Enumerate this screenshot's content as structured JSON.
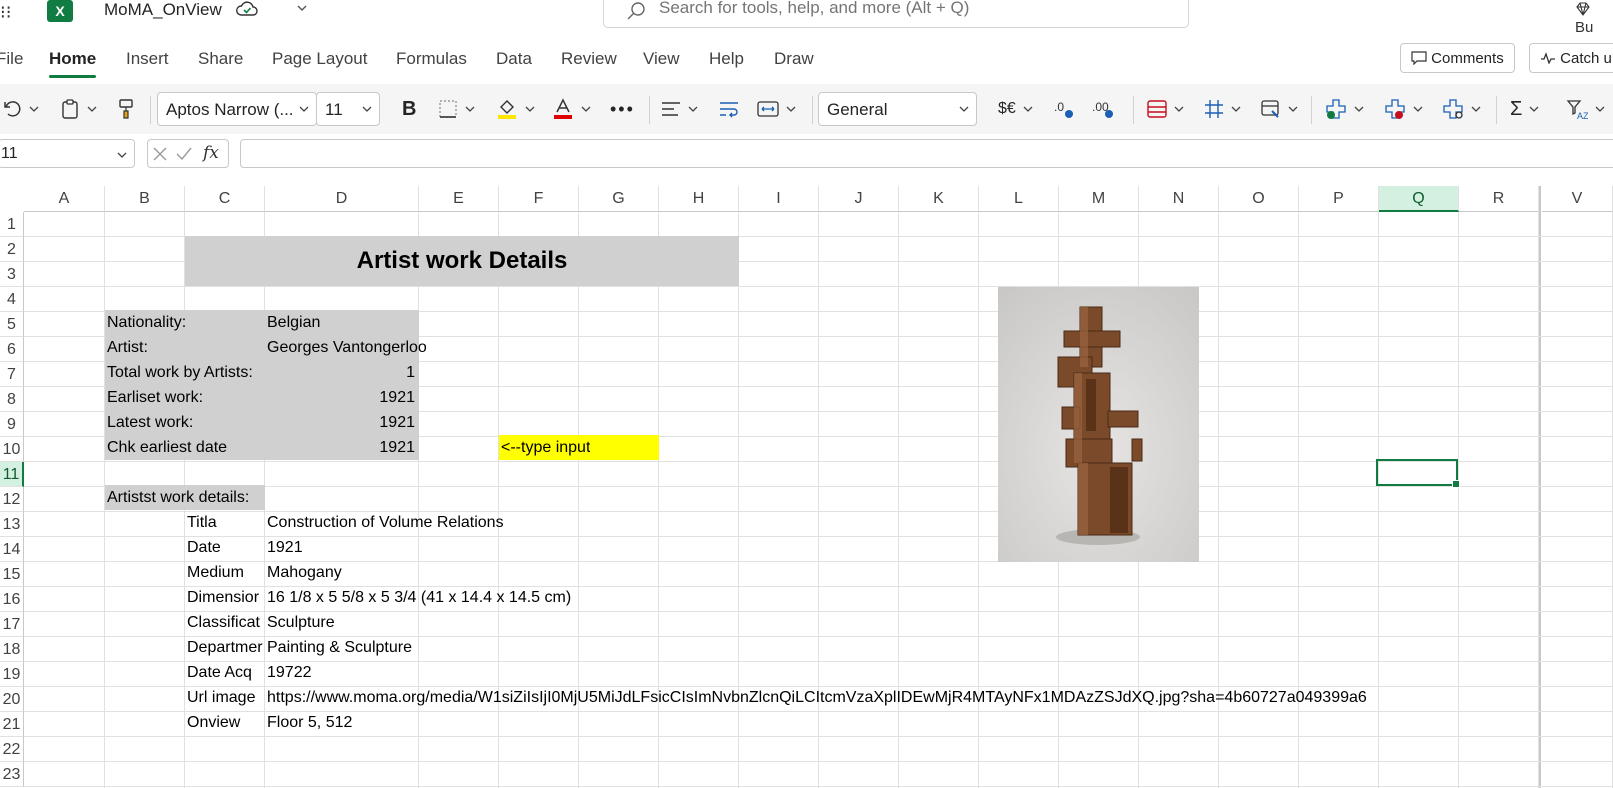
{
  "app": {
    "file_name": "MoMA_OnView",
    "search_placeholder": "Search for tools, help, and more (Alt + Q)",
    "premium_label": "Bu",
    "app_icon_letter": "X"
  },
  "tabs": [
    "File",
    "Home",
    "Insert",
    "Share",
    "Page Layout",
    "Formulas",
    "Data",
    "Review",
    "View",
    "Help",
    "Draw"
  ],
  "active_tab": "Home",
  "top_buttons": {
    "comments": "Comments",
    "catchup": "Catch u"
  },
  "ribbon": {
    "font_name": "Aptos Narrow (...",
    "font_size": "11",
    "number_format": "General",
    "currency_label": "$€",
    "bold_label": "B"
  },
  "formula_bar": {
    "name_box": "11",
    "fx_label": "fx",
    "formula": ""
  },
  "columns": [
    "A",
    "B",
    "C",
    "D",
    "E",
    "F",
    "G",
    "H",
    "I",
    "J",
    "K",
    "L",
    "M",
    "N",
    "O",
    "P",
    "Q",
    "R",
    "V"
  ],
  "selected_column": "Q",
  "rows": [
    "1",
    "2",
    "3",
    "4",
    "5",
    "6",
    "7",
    "8",
    "9",
    "10",
    "11",
    "12",
    "13",
    "14",
    "15",
    "16",
    "17",
    "18",
    "19",
    "20",
    "21",
    "22",
    "23"
  ],
  "selected_row": "11",
  "sheet": {
    "title": "Artist work Details",
    "labels": {
      "nationality": "Nationality:",
      "artist": "Artist:",
      "total": "Total work by Artists:",
      "earliest": "Earliset work:",
      "latest": "Latest work:",
      "chk": "Chk earliest date",
      "details": "Artistst work details:"
    },
    "values": {
      "nationality": "Belgian",
      "artist": "Georges Vantongerloo",
      "total": "1",
      "earliest": "1921",
      "latest": "1921",
      "chk": "1921"
    },
    "input_hint": "<--type input",
    "detail_rows": [
      {
        "label": "Titla",
        "value": "Construction of Volume Relations"
      },
      {
        "label": "Date",
        "value": "1921"
      },
      {
        "label": "Medium",
        "value": "Mahogany"
      },
      {
        "label": "Dimensior",
        "value": "16 1/8 x 5 5/8 x 5 3/4 (41 x 14.4 x 14.5 cm)"
      },
      {
        "label": "Classificat",
        "value": "Sculpture"
      },
      {
        "label": "Departmer",
        "value": "Painting & Sculpture"
      },
      {
        "label": "Date Acq",
        "value": "19722"
      },
      {
        "label": "Url image",
        "value": "https://www.moma.org/media/W1siZiIsIjI0MjU5MiJdLFsicCIsImNvbnZlcnQiLCItcmVzaXplIDEwMjR4MTAyNFx1MDAzZSJdXQ.jpg?sha=4b60727a049399a6"
      },
      {
        "label": "Onview",
        "value": "Floor 5, 512"
      }
    ]
  },
  "colors": {
    "accent": "#107c41",
    "label_fill": "#d0d0d0",
    "hint_fill": "#ffff00"
  }
}
